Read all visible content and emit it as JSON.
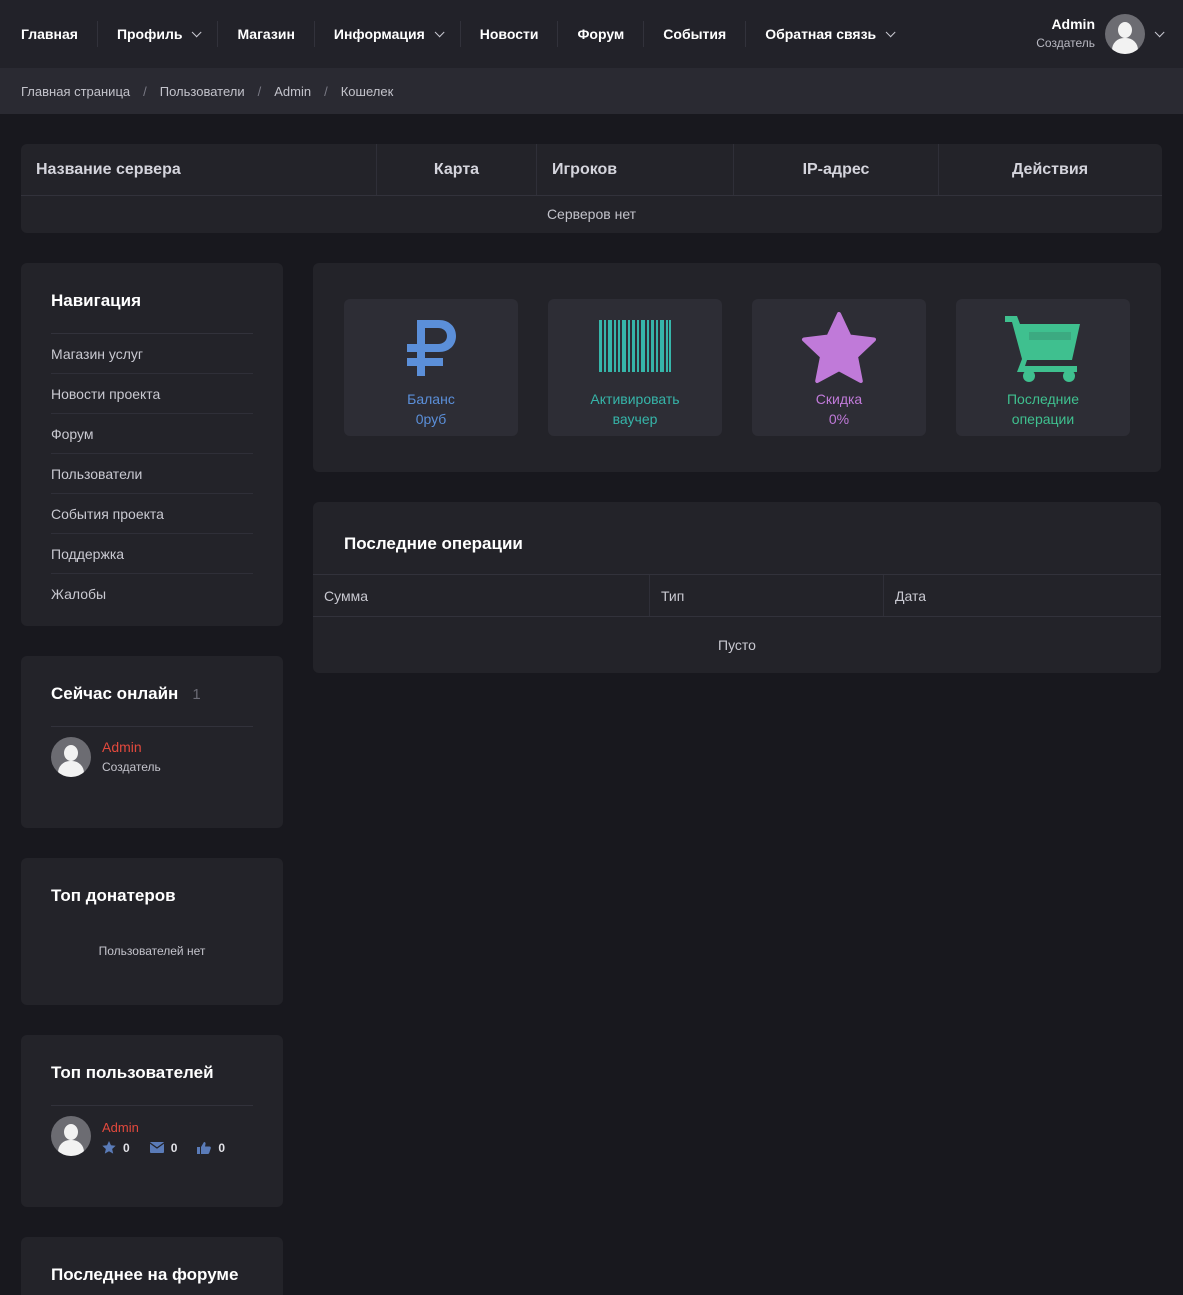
{
  "nav": {
    "items": [
      {
        "label": "Главная",
        "dropdown": false
      },
      {
        "label": "Профиль",
        "dropdown": true
      },
      {
        "label": "Магазин",
        "dropdown": false
      },
      {
        "label": "Информация",
        "dropdown": true
      },
      {
        "label": "Новости",
        "dropdown": false
      },
      {
        "label": "Форум",
        "dropdown": false
      },
      {
        "label": "События",
        "dropdown": false
      },
      {
        "label": "Обратная связь",
        "dropdown": true
      }
    ],
    "user": {
      "name": "Admin",
      "role": "Создатель"
    }
  },
  "breadcrumb": [
    "Главная страница",
    "Пользователи",
    "Admin",
    "Кошелек"
  ],
  "servers": {
    "columns": [
      "Название сервера",
      "Карта",
      "Игроков",
      "IP-адрес",
      "Действия"
    ],
    "empty": "Серверов нет"
  },
  "sidebar": {
    "navigation": {
      "title": "Навигация",
      "links": [
        "Магазин услуг",
        "Новости проекта",
        "Форум",
        "Пользователи",
        "События проекта",
        "Поддержка",
        "Жалобы"
      ]
    },
    "online": {
      "title": "Сейчас онлайн",
      "count": "1",
      "user": {
        "name": "Admin",
        "role": "Создатель"
      }
    },
    "top_donors": {
      "title": "Топ донатеров",
      "empty": "Пользователей нет"
    },
    "top_users": {
      "title": "Топ пользователей",
      "user": {
        "name": "Admin",
        "stars": "0",
        "messages": "0",
        "likes": "0"
      }
    },
    "forum_latest": {
      "title": "Последнее на форуме"
    }
  },
  "wallet": {
    "cards": [
      {
        "icon": "ruble-icon",
        "line1": "Баланс",
        "line2": "0руб",
        "color": "#5b8fd9"
      },
      {
        "icon": "barcode-icon",
        "line1": "Активировать",
        "line2": "ваучер",
        "color": "#36b5a9"
      },
      {
        "icon": "star-icon",
        "line1": "Скидка",
        "line2": "0%",
        "color": "#c07ad9"
      },
      {
        "icon": "cart-icon",
        "line1": "Последние",
        "line2": "операции",
        "color": "#3fc08f"
      }
    ]
  },
  "operations": {
    "title": "Последние операции",
    "columns": [
      "Сумма",
      "Тип",
      "Дата"
    ],
    "empty": "Пусто"
  }
}
